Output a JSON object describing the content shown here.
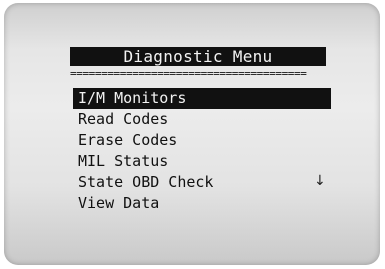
{
  "screen": {
    "title": "Diagnostic Menu",
    "separator": "======================================",
    "scroll_indicator": "↓",
    "scroll_indicator_icon": "arrow-down-icon"
  },
  "menu": {
    "selected_index": 0,
    "items": [
      {
        "label": "I/M Monitors",
        "name": "menu-item-im-monitors"
      },
      {
        "label": "Read Codes",
        "name": "menu-item-read-codes"
      },
      {
        "label": "Erase Codes",
        "name": "menu-item-erase-codes"
      },
      {
        "label": "MIL Status",
        "name": "menu-item-mil-status"
      },
      {
        "label": "State OBD Check",
        "name": "menu-item-state-obd-check"
      },
      {
        "label": "View Data",
        "name": "menu-item-view-data"
      }
    ]
  }
}
